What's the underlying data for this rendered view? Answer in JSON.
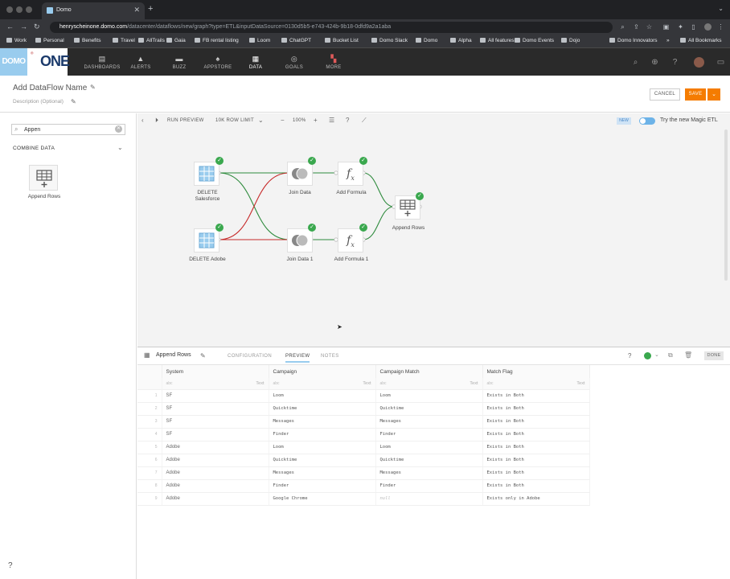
{
  "browser": {
    "tab_title": "Domo",
    "url_host": "henryscheinone.domo.com",
    "url_rest": "/datacenter/dataflows/new/graph?type=ETL&inputDataSource=0130d5b5-e743-424b-9b18-0dfd9a2a1aba",
    "bookmarks": [
      "Work",
      "Personal",
      "Benefits",
      "Travel",
      "AllTrails",
      "Gaia",
      "FB rental listing",
      "Loom",
      "ChatGPT",
      "Bucket List",
      "Domo Slack",
      "Domo",
      "Alpha",
      "All features",
      "Domo Events",
      "Dojo",
      "Domo Innovators"
    ],
    "all_bookmarks": "All Bookmarks"
  },
  "nav": {
    "logo": "DOMO",
    "brand": "ONE",
    "items": [
      "DASHBOARDS",
      "ALERTS",
      "BUZZ",
      "APPSTORE",
      "DATA",
      "GOALS",
      "MORE"
    ]
  },
  "header": {
    "title": "Add DataFlow Name",
    "description": "Description (Optional)",
    "cancel": "CANCEL",
    "save": "SAVE"
  },
  "sidebar": {
    "search_value": "Appen",
    "section": "COMBINE DATA",
    "tile_label": "Append Rows"
  },
  "toolbar": {
    "run_preview": "RUN PREVIEW",
    "row_limit": "10K ROW LIMIT",
    "zoom": "100%",
    "new_badge": "NEW",
    "magic_etl": "Try the new Magic ETL"
  },
  "nodes": {
    "salesforce": "DELETE\nSalesforce",
    "adobe": "DELETE Adobe",
    "join1": "Join Data",
    "join2": "Join Data 1",
    "formula1": "Add Formula",
    "formula2": "Add Formula 1",
    "append": "Append Rows"
  },
  "panel": {
    "title": "Append Rows",
    "tabs": [
      "CONFIGURATION",
      "PREVIEW",
      "NOTES"
    ],
    "done": "DONE",
    "columns": [
      "System",
      "Campaign",
      "Campaign Match",
      "Match Flag"
    ],
    "type_abbr": "abc",
    "type_label": "Text",
    "rows": [
      [
        "1",
        "SF",
        "Loom",
        "Loom",
        "Exists in Both"
      ],
      [
        "2",
        "SF",
        "Quicktime",
        "Quicktime",
        "Exists in Both"
      ],
      [
        "3",
        "SF",
        "Messages",
        "Messages",
        "Exists in Both"
      ],
      [
        "4",
        "SF",
        "Finder",
        "Finder",
        "Exists in Both"
      ],
      [
        "5",
        "Adobe",
        "Loom",
        "Loom",
        "Exists in Both"
      ],
      [
        "6",
        "Adobe",
        "Quicktime",
        "Quicktime",
        "Exists in Both"
      ],
      [
        "7",
        "Adobe",
        "Messages",
        "Messages",
        "Exists in Both"
      ],
      [
        "8",
        "Adobe",
        "Finder",
        "Finder",
        "Exists in Both"
      ],
      [
        "9",
        "Adobe",
        "Google Chrome",
        "null",
        "Exists only in Adobe"
      ]
    ]
  },
  "colors": {
    "accent": "#99ccee",
    "save": "#f57c00",
    "check": "#3aa84e",
    "edge_green": "#2e8b3d",
    "edge_red": "#c62828"
  }
}
